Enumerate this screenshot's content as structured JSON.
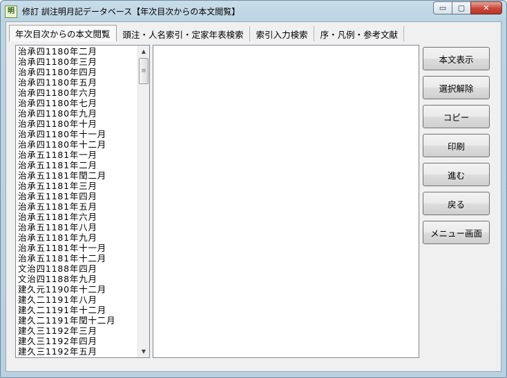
{
  "window": {
    "title": "修訂 訓注明月記データベース【年次目次からの本文閲覧】",
    "icon_text": "明",
    "min_glyph": "▭",
    "max_glyph": "▢",
    "close_glyph": "✕"
  },
  "tabs": [
    {
      "label": "年次目次からの本文閲覧",
      "active": true
    },
    {
      "label": "頭注・人名索引・定家年表検索",
      "active": false
    },
    {
      "label": "索引入力検索",
      "active": false
    },
    {
      "label": "序・凡例・参考文献",
      "active": false
    }
  ],
  "list": {
    "items": [
      "治承四1180年二月",
      "治承四1180年三月",
      "治承四1180年四月",
      "治承四1180年五月",
      "治承四1180年六月",
      "治承四1180年七月",
      "治承四1180年九月",
      "治承四1180年十月",
      "治承四1180年十一月",
      "治承四1180年十二月",
      "治承五1181年一月",
      "治承五1181年二月",
      "治承五1181年閏二月",
      "治承五1181年三月",
      "治承五1181年四月",
      "治承五1181年五月",
      "治承五1181年六月",
      "治承五1181年八月",
      "治承五1181年九月",
      "治承五1181年十一月",
      "治承五1181年十二月",
      "文治四1188年四月",
      "文治四1188年九月",
      "建久元1190年十二月",
      "建久二1191年八月",
      "建久二1191年十二月",
      "建久二1191年閏十二月",
      "建久三1192年三月",
      "建久三1192年四月",
      "建久三1192年五月"
    ],
    "scroll_up": "▲",
    "scroll_down": "▼",
    "thumb_grip": "≡"
  },
  "buttons": {
    "show_text": "本文表示",
    "deselect": "選択解除",
    "copy": "コピー",
    "print": "印刷",
    "forward": "進む",
    "back": "戻る",
    "menu": "メニュー画面"
  }
}
